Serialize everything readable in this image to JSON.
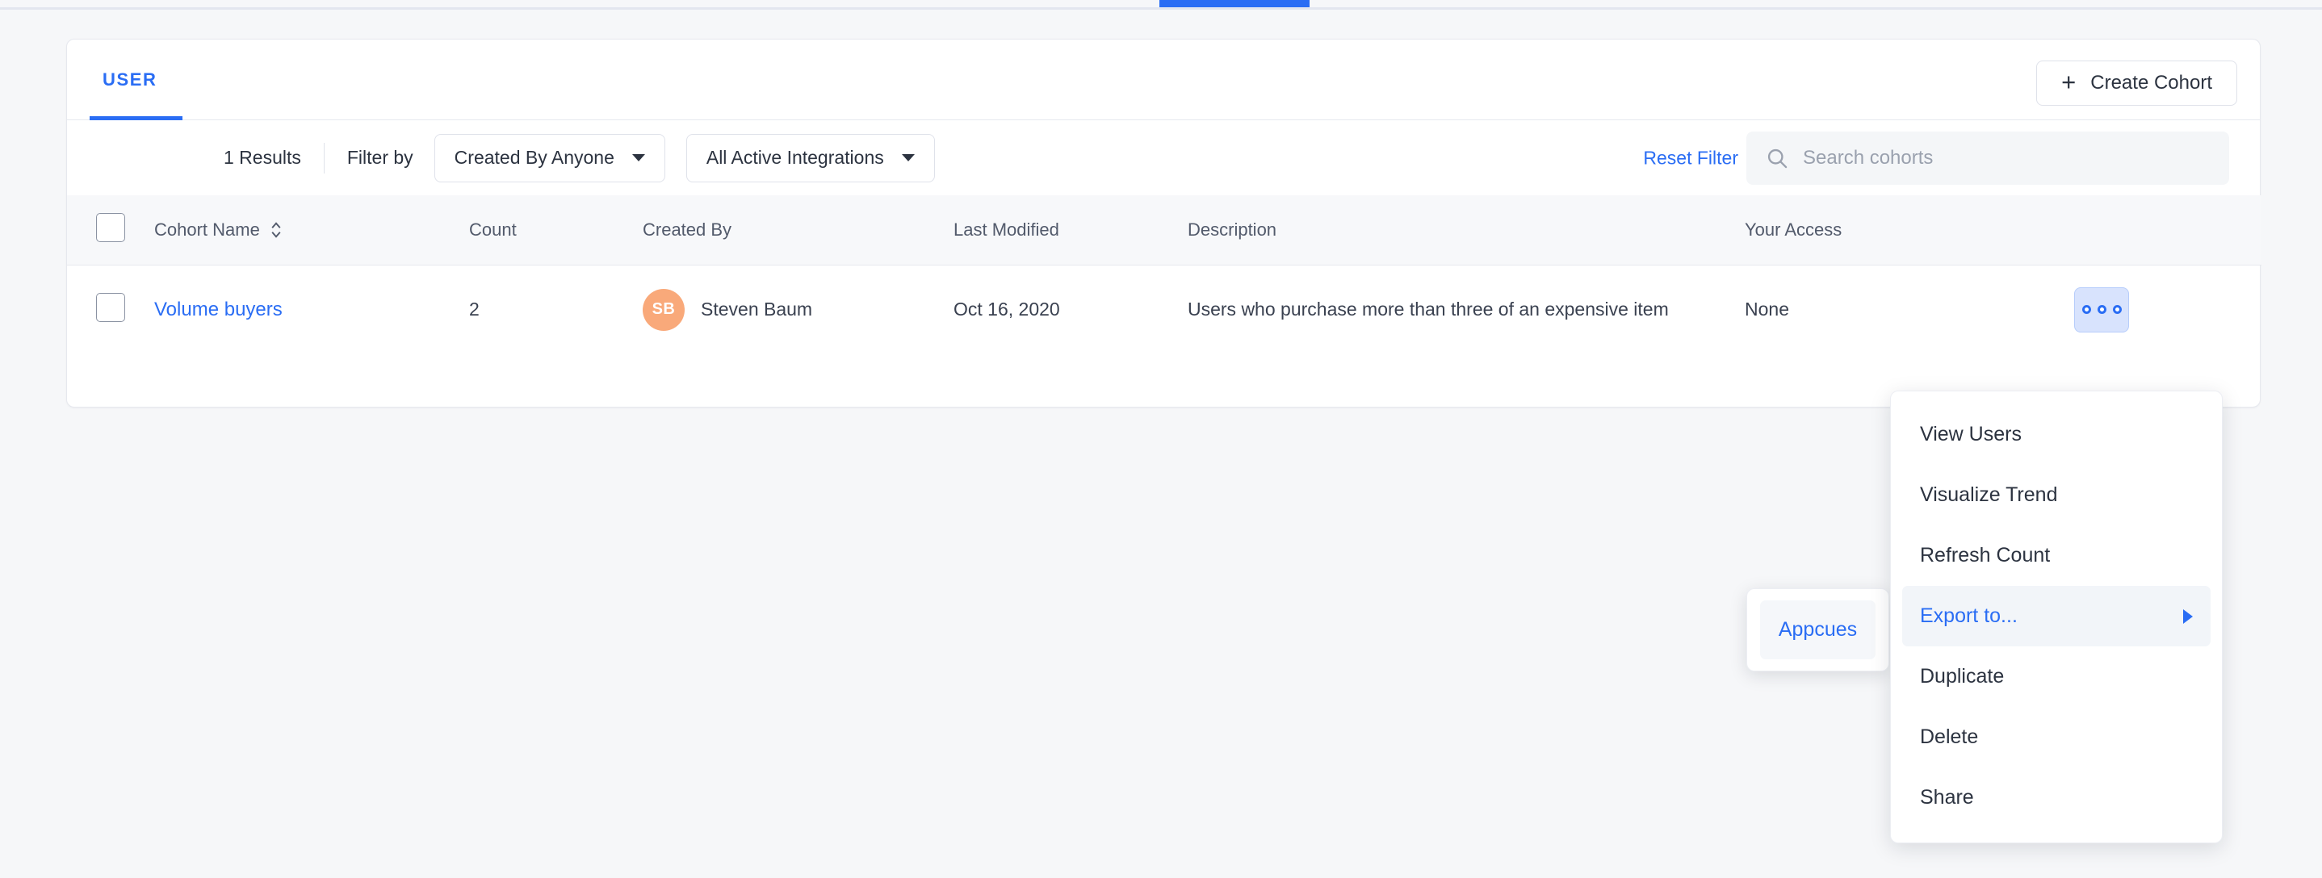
{
  "top_tab_indicator": {
    "color": "#2a6df4"
  },
  "card": {
    "tabs": [
      {
        "label": "USER",
        "active": true
      }
    ],
    "create_button": {
      "label": "Create Cohort",
      "icon": "plus-icon"
    }
  },
  "filter_bar": {
    "results_count": "1 Results",
    "filter_by_label": "Filter by",
    "dropdowns": [
      {
        "label": "Created By Anyone"
      },
      {
        "label": "All Active Integrations"
      }
    ],
    "reset_filter_label": "Reset Filter",
    "search": {
      "placeholder": "Search cohorts",
      "value": "",
      "icon": "search-icon"
    }
  },
  "table": {
    "columns": [
      "Cohort Name",
      "Count",
      "Created By",
      "Last Modified",
      "Description",
      "Your Access"
    ],
    "sort_column": "Cohort Name",
    "rows": [
      {
        "selected": false,
        "name": "Volume buyers",
        "count": "2",
        "created_by": "Steven Baum",
        "created_by_initials": "SB",
        "avatar_color": "#f9a97a",
        "last_modified": "Oct 16, 2020",
        "description": "Users who purchase more than three of an expensive item",
        "your_access": "None",
        "actions_icon": "ellipsis-icon"
      }
    ]
  },
  "context_menu": {
    "items": [
      {
        "label": "View Users",
        "active": false,
        "submenu": false
      },
      {
        "label": "Visualize Trend",
        "active": false,
        "submenu": false
      },
      {
        "label": "Refresh Count",
        "active": false,
        "submenu": false
      },
      {
        "label": "Export to...",
        "active": true,
        "submenu": true
      },
      {
        "label": "Duplicate",
        "active": false,
        "submenu": false
      },
      {
        "label": "Delete",
        "active": false,
        "submenu": false
      },
      {
        "label": "Share",
        "active": false,
        "submenu": false
      }
    ]
  },
  "submenu": {
    "items": [
      {
        "label": "Appcues"
      }
    ]
  },
  "colors": {
    "accent": "#2a6df4",
    "page_bg": "#f6f7f9",
    "card_bg": "#ffffff",
    "header_row_bg": "#f7f8fa",
    "avatar": "#f9a97a"
  }
}
